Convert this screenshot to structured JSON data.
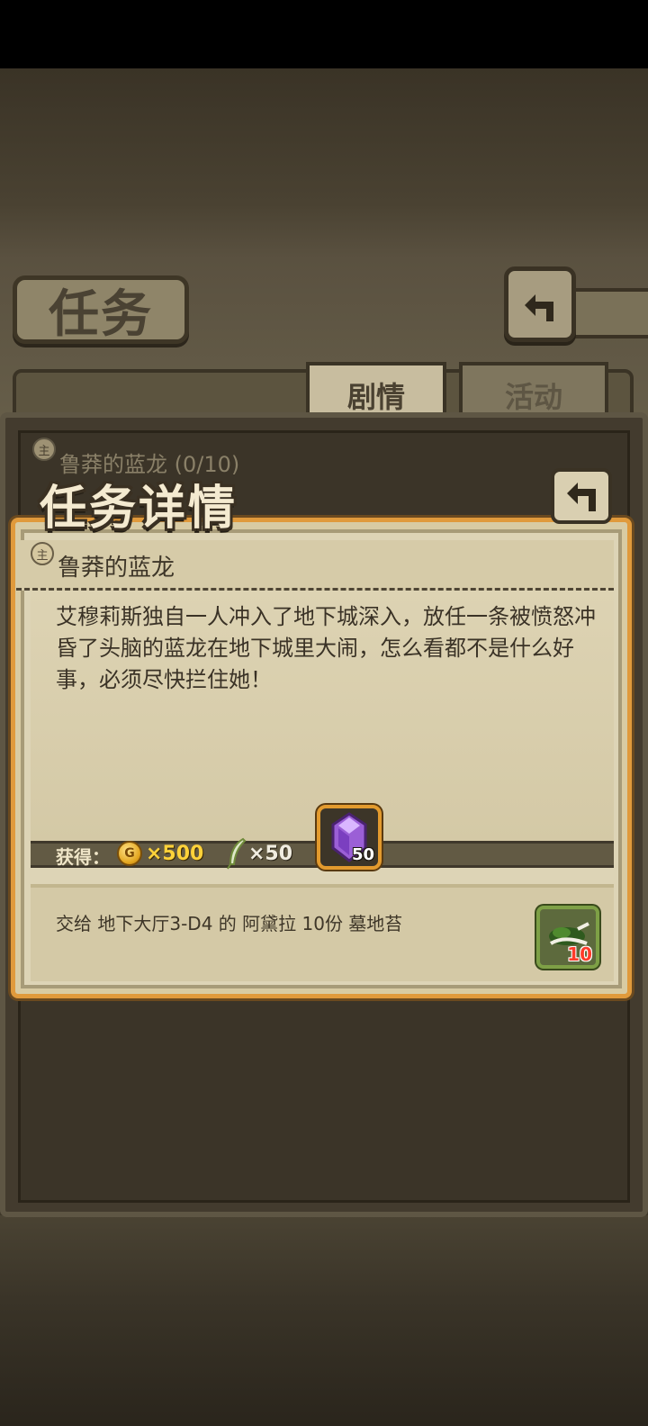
{
  "header": {
    "title": "任务"
  },
  "tabs": [
    {
      "label": "剧情",
      "active": true
    },
    {
      "label": "活动",
      "active": false
    }
  ],
  "quest_list": {
    "items": [
      {
        "icon_text": "主",
        "title": "鲁莽的蓝龙 (0/10)"
      }
    ]
  },
  "detail": {
    "dialog_title": "任务详情",
    "quest_icon_text": "主",
    "quest_name": "鲁莽的蓝龙",
    "description": "艾穆莉斯独自一人冲入了地下城深入，放任一条被愤怒冲昏了头脑的蓝龙在地下城里大闹，怎么看都不是什么好事，必须尽快拦住她！",
    "rewards": {
      "label": "获得：",
      "gold_icon_text": "G",
      "gold": "×500",
      "feather": "×50",
      "crystal_count": "50"
    },
    "objective": "交给 地下大厅3-D4 的 阿黛拉 10份 墓地苔",
    "required_item_count": "10"
  },
  "colors": {
    "accent_orange": "#e09a3c",
    "gold_text": "#ffd23a",
    "item_count_red": "#ff3b2a",
    "crystal_purple": "#9b5fd6"
  },
  "icons": [
    "back-arrow-icon",
    "close-arrow-icon",
    "gold-coin-icon",
    "feather-icon",
    "purple-crystal-icon",
    "moss-item-icon",
    "main-quest-icon"
  ]
}
